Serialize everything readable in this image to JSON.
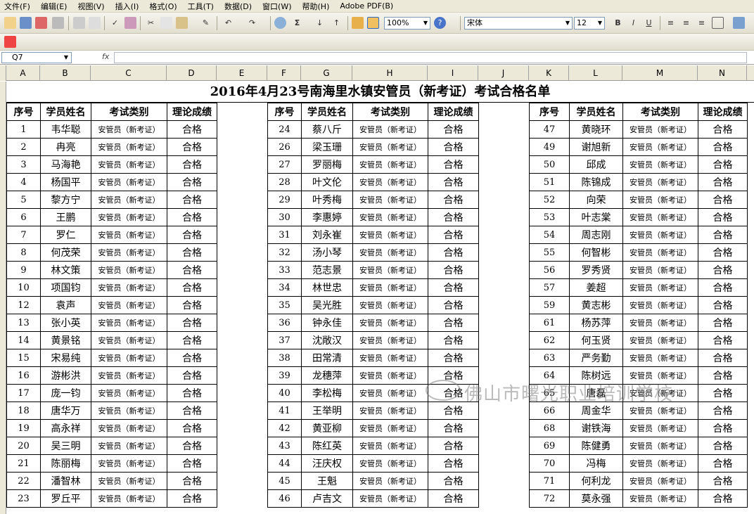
{
  "menu": [
    "文件(F)",
    "编辑(E)",
    "视图(V)",
    "插入(I)",
    "格式(O)",
    "工具(T)",
    "数据(D)",
    "窗口(W)",
    "帮助(H)",
    "Adobe PDF(B)"
  ],
  "toolbar": {
    "zoom": "100%",
    "font_name": "宋体",
    "font_size": "12"
  },
  "formula_bar": {
    "name_box": "Q7",
    "fx_label": "fx",
    "formula": ""
  },
  "columns": [
    "A",
    "B",
    "C",
    "D",
    "E",
    "F",
    "G",
    "H",
    "I",
    "J",
    "K",
    "L",
    "M",
    "N"
  ],
  "sheet": {
    "title": "2016年4月23号南海里水镇安管员（新考证）考试合格名单",
    "headers": [
      "序号",
      "学员姓名",
      "考试类别",
      "理论成绩"
    ],
    "category": "安管员（新考证）",
    "result": "合格",
    "blocks": [
      [
        [
          "1",
          "韦华聪"
        ],
        [
          "2",
          "冉亮"
        ],
        [
          "3",
          "马海艳"
        ],
        [
          "4",
          "杨国平"
        ],
        [
          "5",
          "黎方宁"
        ],
        [
          "6",
          "王鹏"
        ],
        [
          "7",
          "罗仁"
        ],
        [
          "8",
          "何茂荣"
        ],
        [
          "9",
          "林文策"
        ],
        [
          "10",
          "项国钧"
        ],
        [
          "12",
          "袁声"
        ],
        [
          "13",
          "张小英"
        ],
        [
          "14",
          "黄景铭"
        ],
        [
          "15",
          "宋易纯"
        ],
        [
          "16",
          "游彬洪"
        ],
        [
          "17",
          "庞一钧"
        ],
        [
          "18",
          "唐华万"
        ],
        [
          "19",
          "高永祥"
        ],
        [
          "20",
          "吴三明"
        ],
        [
          "21",
          "陈丽梅"
        ],
        [
          "22",
          "潘智林"
        ],
        [
          "23",
          "罗丘平"
        ]
      ],
      [
        [
          "24",
          "蔡八斤"
        ],
        [
          "26",
          "梁玉珊"
        ],
        [
          "27",
          "罗丽梅"
        ],
        [
          "28",
          "叶文伦"
        ],
        [
          "29",
          "叶秀梅"
        ],
        [
          "30",
          "李惠婷"
        ],
        [
          "31",
          "刘永崔"
        ],
        [
          "32",
          "汤小琴"
        ],
        [
          "33",
          "范志景"
        ],
        [
          "34",
          "林世忠"
        ],
        [
          "35",
          "吴光胜"
        ],
        [
          "36",
          "钟永佳"
        ],
        [
          "37",
          "沈敞汉"
        ],
        [
          "38",
          "田常清"
        ],
        [
          "39",
          "龙穗萍"
        ],
        [
          "40",
          "李松梅"
        ],
        [
          "41",
          "王举明"
        ],
        [
          "42",
          "黄亚柳"
        ],
        [
          "43",
          "陈红英"
        ],
        [
          "44",
          "汪庆权"
        ],
        [
          "45",
          "王魁"
        ],
        [
          "46",
          "卢吉文"
        ]
      ],
      [
        [
          "47",
          "黄晓环"
        ],
        [
          "49",
          "谢旭新"
        ],
        [
          "50",
          "邱成"
        ],
        [
          "51",
          "陈锦成"
        ],
        [
          "52",
          "向荣"
        ],
        [
          "53",
          "叶志棠"
        ],
        [
          "54",
          "周志刚"
        ],
        [
          "55",
          "何智彬"
        ],
        [
          "56",
          "罗秀贤"
        ],
        [
          "57",
          "姜超"
        ],
        [
          "59",
          "黄志彬"
        ],
        [
          "61",
          "杨苏萍"
        ],
        [
          "62",
          "何玉贤"
        ],
        [
          "63",
          "严务勤"
        ],
        [
          "64",
          "陈树远"
        ],
        [
          "65",
          "唐磊"
        ],
        [
          "66",
          "周金华"
        ],
        [
          "68",
          "谢铁海"
        ],
        [
          "69",
          "陈健勇"
        ],
        [
          "70",
          "冯梅"
        ],
        [
          "71",
          "何利龙"
        ],
        [
          "72",
          "莫永强"
        ]
      ]
    ]
  },
  "watermark": "佛山市曙光职业培训学校"
}
